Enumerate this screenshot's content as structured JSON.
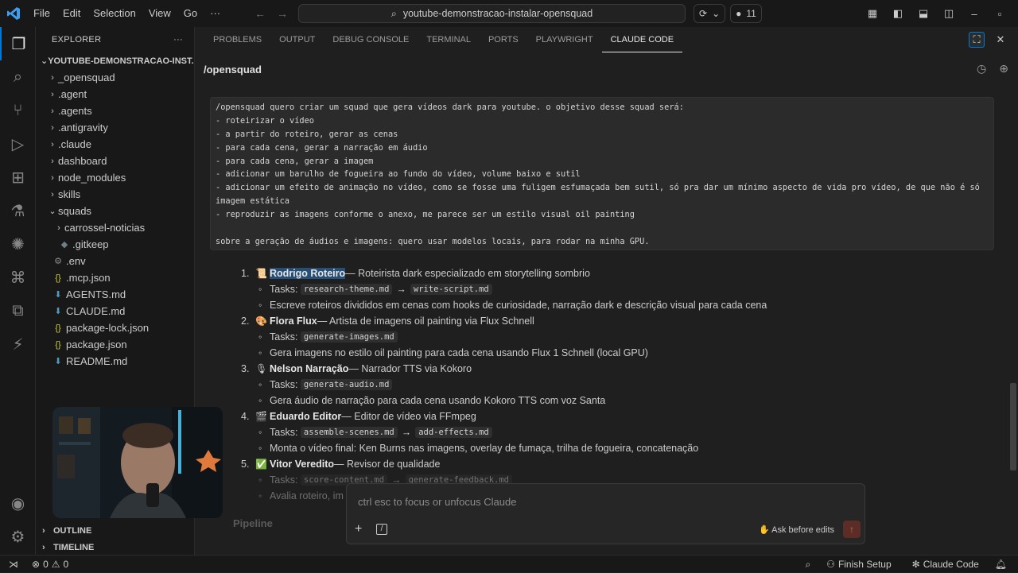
{
  "titlebar": {
    "menu": [
      "File",
      "Edit",
      "Selection",
      "View",
      "Go",
      "···"
    ],
    "search_text": "youtube-demonstracao-instalar-opensquad",
    "notif_count": "11"
  },
  "explorer": {
    "header": "EXPLORER",
    "root": "YOUTUBE-DEMONSTRACAO-INST...",
    "items": [
      {
        "chev": "›",
        "icon": "",
        "label": "_opensquad"
      },
      {
        "chev": "›",
        "icon": "",
        "label": ".agent"
      },
      {
        "chev": "›",
        "icon": "",
        "label": ".agents"
      },
      {
        "chev": "›",
        "icon": "",
        "label": ".antigravity"
      },
      {
        "chev": "›",
        "icon": "",
        "label": ".claude"
      },
      {
        "chev": "›",
        "icon": "",
        "label": "dashboard"
      },
      {
        "chev": "›",
        "icon": "",
        "label": "node_modules"
      },
      {
        "chev": "›",
        "icon": "",
        "label": "skills"
      },
      {
        "chev": "⌄",
        "icon": "",
        "label": "squads"
      },
      {
        "chev": "›",
        "icon": "",
        "label": "carrossel-noticias"
      },
      {
        "chev": "",
        "icon": "◆",
        "label": ".gitkeep"
      },
      {
        "chev": "",
        "icon": "⚙",
        "label": ".env"
      },
      {
        "chev": "",
        "icon": "{}",
        "label": ".mcp.json"
      },
      {
        "chev": "",
        "icon": "⬇",
        "label": "AGENTS.md"
      },
      {
        "chev": "",
        "icon": "⬇",
        "label": "CLAUDE.md"
      },
      {
        "chev": "",
        "icon": "{}",
        "label": "package-lock.json"
      },
      {
        "chev": "",
        "icon": "{}",
        "label": "package.json"
      },
      {
        "chev": "",
        "icon": "⬇",
        "label": "README.md"
      }
    ],
    "outline": "OUTLINE",
    "timeline": "TIMELINE"
  },
  "panel": {
    "tabs": [
      "PROBLEMS",
      "OUTPUT",
      "DEBUG CONSOLE",
      "TERMINAL",
      "PORTS",
      "PLAYWRIGHT",
      "CLAUDE CODE"
    ],
    "active_tab": "CLAUDE CODE",
    "title": "/opensquad"
  },
  "prompt": [
    "/opensquad quero criar um squad que gera vídeos dark para youtube. o objetivo desse squad será:",
    "- roteirizar o vídeo",
    "- a partir do roteiro, gerar as cenas",
    "- para cada cena, gerar a narração em áudio",
    "- para cada cena, gerar a imagem",
    "- adicionar um barulho de fogueira ao fundo do vídeo, volume baixo e sutil",
    "- adicionar um efeito de animação no vídeo, como se fosse uma fuligem esfumaçada bem sutil, só pra dar um mínimo aspecto de vida pro vídeo, de que não é só",
    "imagem estática",
    "- reproduzir as imagens conforme o anexo, me parece ser um estilo visual oil painting",
    "",
    "sobre a geração de áudios e imagens: quero usar modelos locais, para rodar na minha GPU."
  ],
  "agents": [
    {
      "num": "1.",
      "emoji": "📜",
      "name": "Rodrigo Roteiro",
      "desc": " — Roteirista dark especializado em storytelling sombrio",
      "tasks_label": "Tasks:",
      "tasks": [
        "research-theme.md",
        "write-script.md"
      ],
      "detail": "Escreve roteiros divididos em cenas com hooks de curiosidade, narração dark e descrição visual para cada cena"
    },
    {
      "num": "2.",
      "emoji": "🎨",
      "name": "Flora Flux",
      "desc": " — Artista de imagens oil painting via Flux Schnell",
      "tasks_label": "Tasks:",
      "tasks": [
        "generate-images.md"
      ],
      "detail": "Gera imagens no estilo oil painting para cada cena usando Flux 1 Schnell (local GPU)"
    },
    {
      "num": "3.",
      "emoji": "🎙",
      "name": "Nelson Narração",
      "desc": " — Narrador TTS via Kokoro",
      "tasks_label": "Tasks:",
      "tasks": [
        "generate-audio.md"
      ],
      "detail": "Gera áudio de narração para cada cena usando Kokoro TTS com voz Santa"
    },
    {
      "num": "4.",
      "emoji": "🎬",
      "name": "Eduardo Editor",
      "desc": " — Editor de vídeo via FFmpeg",
      "tasks_label": "Tasks:",
      "tasks": [
        "assemble-scenes.md",
        "add-effects.md"
      ],
      "detail": "Monta o vídeo final: Ken Burns nas imagens, overlay de fumaça, trilha de fogueira, concatenação"
    },
    {
      "num": "5.",
      "emoji": "✅",
      "name": "Vitor Veredito",
      "desc": " — Revisor de qualidade",
      "tasks_label": "Tasks:",
      "tasks": [
        "score-content.md",
        "generate-feedback.md"
      ],
      "detail": "Avalia roteiro, im"
    }
  ],
  "pipeline_heading": "Pipeline",
  "composer": {
    "placeholder": "ctrl esc to focus or unfocus Claude",
    "mode": "Ask before edits"
  },
  "statusbar": {
    "errors": "0",
    "warnings": "0",
    "finish_setup": "Finish Setup",
    "claude_code": "Claude Code"
  },
  "colors": {
    "accent": "#0078d4",
    "selection": "#264f78",
    "background": "#1f1f1f"
  }
}
